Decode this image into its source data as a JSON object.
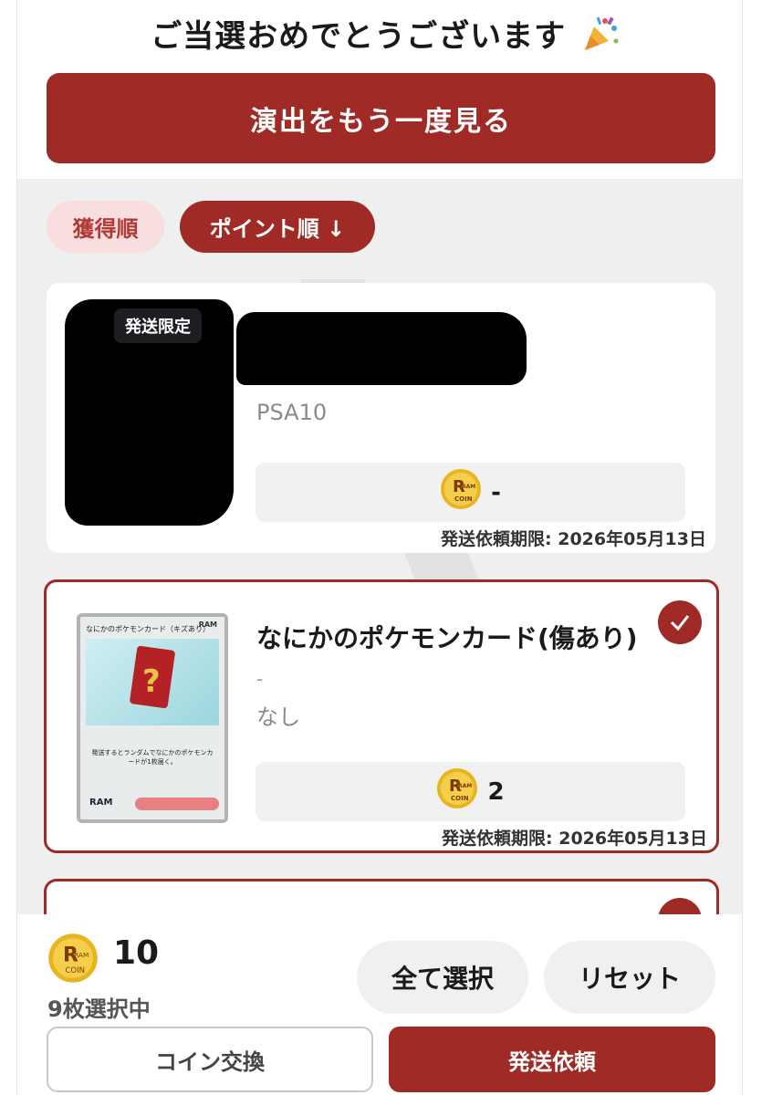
{
  "header": {
    "title": "ご当選おめでとうございます",
    "icon": "party-popper-icon"
  },
  "replay_button": {
    "label": "演出をもう一度見る"
  },
  "sort": {
    "acquired_label": "獲得順",
    "points_label": "ポイント順 ↓"
  },
  "items": [
    {
      "badge": "発送限定",
      "grade": "PSA10",
      "coin_value": "-",
      "deadline": "発送依頼期限: 2026年05月13日",
      "selected": false
    },
    {
      "title": "なにかのポケモンカード(傷あり)",
      "dash": "-",
      "grade": "なし",
      "coin_value": "2",
      "deadline": "発送依頼期限: 2026年05月13日",
      "selected": true,
      "card_image": {
        "name": "なにかのポケモンカード（キズあり）",
        "brand": "RAM",
        "text": "発送するとランダムでなにかのポケモンカードが1枚届く。"
      }
    }
  ],
  "footer": {
    "total_coins": "10",
    "selected_count": "9枚選択中",
    "select_all_label": "全て選択",
    "reset_label": "リセット",
    "coin_exchange_label": "コイン交換",
    "ship_request_label": "発送依頼"
  },
  "coin": {
    "line1": "RAM",
    "line2": "COIN"
  },
  "colors": {
    "accent": "#a02a26",
    "accent_light": "#f8dede",
    "coin_gold": "#e9b422"
  }
}
